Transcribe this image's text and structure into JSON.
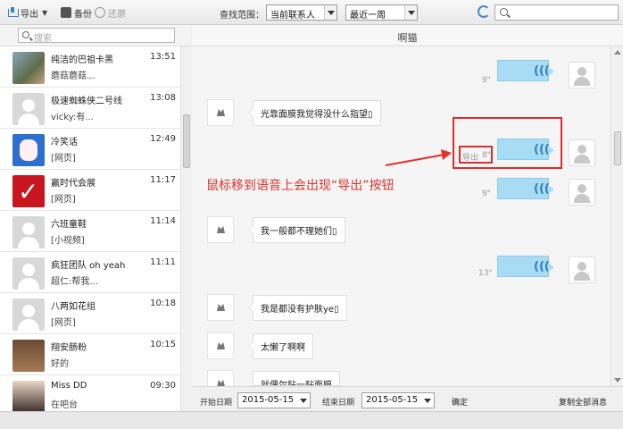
{
  "toolbar": {
    "export_label": "导出",
    "backup_label": "备份",
    "restore_label": "还原",
    "search_range_label": "查找范围：",
    "range_select": "当前联系人",
    "period_select": "最近一周"
  },
  "left": {
    "search_placeholder": "搜索",
    "contacts": [
      {
        "name": "纯洁的巴祖卡黑",
        "time": "13:51",
        "msg": "蘑菇蘑菇..."
      },
      {
        "name": "极速蜘蛛侠二号线",
        "time": "13:08",
        "msg": "vicky:有..."
      },
      {
        "name": "冷笑话",
        "time": "12:49",
        "msg": "[网页]"
      },
      {
        "name": "赢时代会展",
        "time": "11:17",
        "msg": "[网页]"
      },
      {
        "name": "六班童鞋",
        "time": "11:14",
        "msg": "[小视频]"
      },
      {
        "name": "疯狂团队 oh yeah",
        "time": "11:11",
        "msg": "超仁:帮我..."
      },
      {
        "name": "八两如花组",
        "time": "10:18",
        "msg": "[网页]"
      },
      {
        "name": "翔安肠粉",
        "time": "10:15",
        "msg": "好的"
      },
      {
        "name": "Miss DD",
        "time": "09:30",
        "msg": "在吧台"
      }
    ]
  },
  "chat": {
    "title": "啊猫",
    "voices": [
      {
        "duration": "9\""
      },
      {
        "duration": "8\""
      },
      {
        "duration": "9\""
      },
      {
        "duration": "13\""
      }
    ],
    "messages": [
      {
        "text": "光靠面膜我觉得没什么指望▯"
      },
      {
        "text": "我一般都不理她们▯"
      },
      {
        "text": "我是都没有护肤ye▯"
      },
      {
        "text": "太懒了啊啊"
      },
      {
        "text": "就偶尔贴一贴面膜"
      }
    ],
    "export_text": "导出",
    "annotation": "鼠标移到语音上会出现“导出”按钮"
  },
  "bottom": {
    "start_label": "开始日期",
    "start_date": "2015-05-15",
    "end_label": "结束日期",
    "end_date": "2015-05-15",
    "confirm": "确定",
    "copy_all": "复制全部消息"
  },
  "colors": {
    "voice_bubble": "#a8dcf5",
    "annotation_red": "#e0322b"
  }
}
